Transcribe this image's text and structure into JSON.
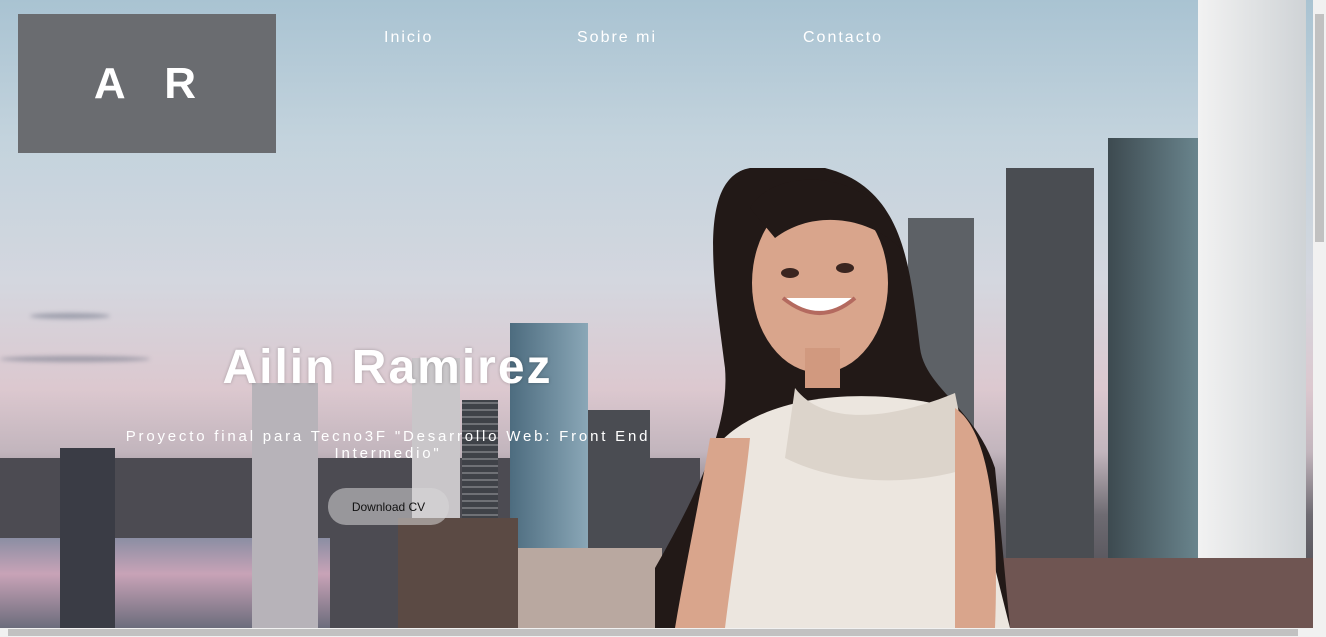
{
  "logo": {
    "text": "A R"
  },
  "nav": {
    "items": [
      {
        "label": "Inicio"
      },
      {
        "label": "Sobre mi"
      },
      {
        "label": "Contacto"
      }
    ]
  },
  "hero": {
    "title": "Ailin Ramirez",
    "subtitle": "Proyecto final para Tecno3F \"Desarrollo Web: Front End Intermedio\"",
    "button_label": "Download CV"
  },
  "colors": {
    "logo_bg": "#6a6c70",
    "text": "#ffffff"
  },
  "icons": {
    "portrait": "portrait-photo",
    "background": "city-skyline-photo"
  }
}
